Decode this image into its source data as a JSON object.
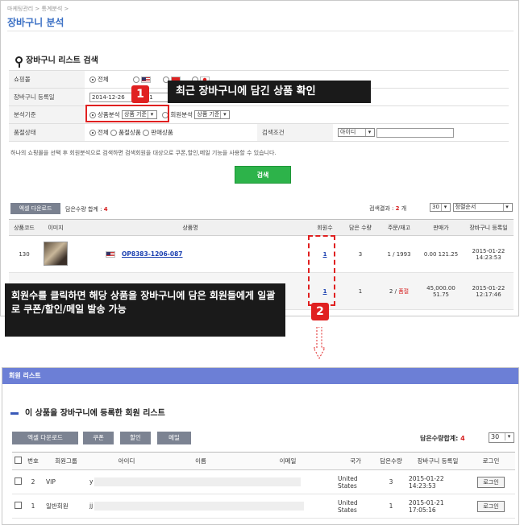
{
  "top": {
    "breadcrumb": "마케팅관리 > 통계분석 >",
    "title": "장바구니 분석",
    "section_title": "장바구니 리스트 검색",
    "form": {
      "mall_label": "쇼핑몰",
      "mall_all": "전체",
      "date_label": "장바구니 등록일",
      "date_from": "2014-12-26",
      "date_to": "201",
      "basis_label": "분석기준",
      "basis_product": "상품분석",
      "basis_product_select": "상품 기준",
      "basis_member": "회원분석",
      "basis_member_select": "상품 기준",
      "status_label": "품절상태",
      "status_all": "전체",
      "status_soldout": "품절상품",
      "status_selling": "판매상품",
      "cond_label": "검색조건",
      "cond_select": "아이디",
      "cond_value": ""
    },
    "note": "하나의 쇼핑몰을 선택 후 회원분석으로 검색하면 검색회원을 대상으로 쿠폰,할인,메일 기능을 사용할 수 있습니다.",
    "search_button": "검색",
    "excel_button": "엑셀 다운로드",
    "total_qty_label": "담은수량 합계 :",
    "total_qty_value": "4",
    "result_label": "검색결과 :",
    "result_count": "2",
    "result_unit": "개",
    "page_size": "30",
    "sort": "정렬순서",
    "columns": [
      "상품코드",
      "이미지",
      "상품명",
      "회원수",
      "담은 수량",
      "주문/재고",
      "판매가",
      "장바구니 등록일"
    ],
    "rows": [
      {
        "code": "130",
        "name": "OP8383-1206-087",
        "members": "1",
        "qty": "3",
        "order_stock": "1 / 1993",
        "soldout": "",
        "price": "0.00 121.25",
        "date": "2015-01-22",
        "time": "14:23:53"
      },
      {
        "code": "",
        "name": "",
        "members": "1",
        "qty": "1",
        "order_stock": "2 /",
        "soldout": "품절",
        "price": "45,000.00",
        "price2": "51.75",
        "date": "2015-01-22",
        "time": "12:17:46"
      }
    ],
    "callout1_num": "1",
    "callout1_text": "최근 장바구니에 담긴 상품 확인",
    "callout2_num": "2",
    "callout2_text": "회원수를 클릭하면 해당 상품을 장바구니에 담은 회원들에게 일괄로 쿠폰/할인/메일  발송 가능"
  },
  "bottom": {
    "title": "회원 리스트",
    "section_title": "이 상품을 장바구니에 등록한 회원 리스트",
    "buttons": [
      "엑셀 다운로드",
      "쿠폰",
      "할인",
      "메일"
    ],
    "qty_label": "담은수량합계:",
    "qty_value": "4",
    "page_size": "30",
    "columns": [
      "번호",
      "회원그룹",
      "아이디",
      "이름",
      "이메일",
      "국가",
      "담은수량",
      "장바구니 등록일",
      "로그인"
    ],
    "rows": [
      {
        "no": "2",
        "group": "VIP",
        "id": "y",
        "country": "United States",
        "qty": "3",
        "date": "2015-01-22",
        "time": "14:23:53",
        "login": "로그인"
      },
      {
        "no": "1",
        "group": "일반회원",
        "id": "jj",
        "country": "United States",
        "qty": "1",
        "date": "2015-01-21",
        "time": "17:05:16",
        "login": "로그인"
      }
    ]
  },
  "colors": {
    "accent_red": "#e02020",
    "green_button": "#2db34a",
    "header_bar": "#6c7fd6",
    "link_blue": "#1a3fb0"
  }
}
